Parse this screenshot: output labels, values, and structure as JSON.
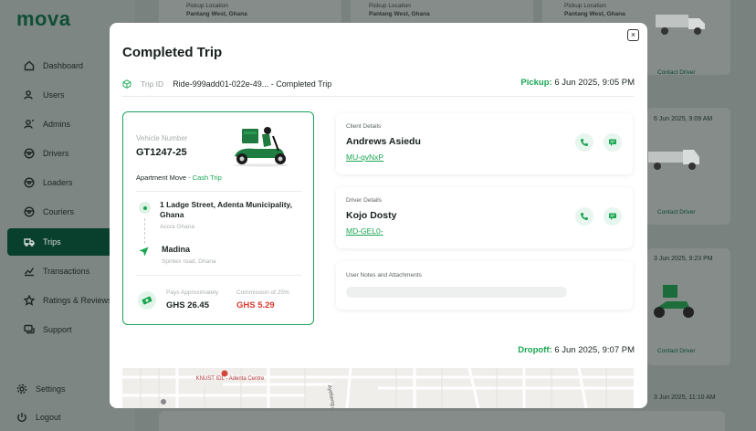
{
  "app": {
    "logo": "mova"
  },
  "sidebar": {
    "items": [
      {
        "label": "Dashboard"
      },
      {
        "label": "Users"
      },
      {
        "label": "Admins"
      },
      {
        "label": "Drivers"
      },
      {
        "label": "Loaders"
      },
      {
        "label": "Couriers"
      },
      {
        "label": "Trips"
      },
      {
        "label": "Transactions"
      },
      {
        "label": "Ratings & Reviews"
      },
      {
        "label": "Support"
      }
    ],
    "settings": "Settings",
    "logout": "Logout"
  },
  "background": {
    "pickup_label": "Pickup Location",
    "pickup_value": "Pantang West, Ghana",
    "contact_driver": "Contact Driver",
    "dates": [
      "6 Jun 2025, 9:09 AM",
      "3 Jun 2025, 9:23 PM",
      "3 Jun 2025, 11:10 AM"
    ]
  },
  "modal": {
    "title": "Completed Trip",
    "close": "×",
    "trip_id_label": "Trip ID",
    "trip_id_value": "Ride-999add01-022e-49... - Completed Trip",
    "pickup_label": "Pickup:",
    "pickup_time": "6 Jun 2025, 9:05 PM",
    "dropoff_label": "Dropoff:",
    "dropoff_time": "6 Jun 2025, 9:07 PM",
    "vehicle": {
      "label": "Vehicle Number",
      "number": "GT1247-25",
      "move_type": "Apartment Move",
      "payment": "- Cash Trip",
      "origin": "1 Ladge Street, Adenta Municipality, Ghana",
      "origin_sub": "Accra Ghana",
      "destination": "Madina",
      "destination_sub": "Spintex road, Ghana",
      "pays_label": "Pays Approximately",
      "pays_value": "GHS 26.45",
      "commission_label": "Commission of 25%",
      "commission_value": "GHS 5.29"
    },
    "client": {
      "label": "Client Details",
      "name": "Andrews Asiedu",
      "id": "MU-qvNxP"
    },
    "driver": {
      "label": "Driver Details",
      "name": "Kojo Dosty",
      "id": "MD-GEL0-"
    },
    "notes": {
      "label": "User Notes and Attachments"
    },
    "map": {
      "place": "KNUST IDL - Adenta Centre",
      "road": "Ayebeng Avenue"
    }
  },
  "colors": {
    "brand_dark": "#093f2d",
    "accent_green": "#19a552",
    "danger": "#d83a30"
  }
}
